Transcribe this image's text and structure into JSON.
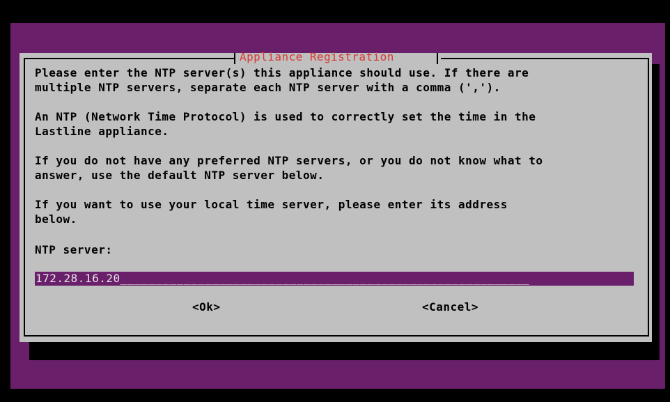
{
  "dialog": {
    "title": "Appliance Registration",
    "paragraphs": [
      "Please enter the NTP server(s) this appliance should use. If there are\nmultiple NTP servers, separate each NTP server with a comma (',').",
      "An NTP (Network Time Protocol) is used to correctly set the time in the\nLastline appliance.",
      "If you do not have any preferred NTP servers, or you do not know what to\nanswer, use the default NTP server below.",
      "If you want to use your local time server, please enter its address\nbelow."
    ],
    "field_label": "NTP server:",
    "field_value": "172.28.16.20",
    "field_fill": "__________________________________________________________",
    "ok_label": "<Ok>",
    "cancel_label": "<Cancel>"
  },
  "colors": {
    "console_background": "#6a1f6a",
    "dialog_background": "#c0c0c0",
    "title": "#d63a32",
    "input_background": "#6a1f6a",
    "input_text": "#e6e6e6"
  }
}
